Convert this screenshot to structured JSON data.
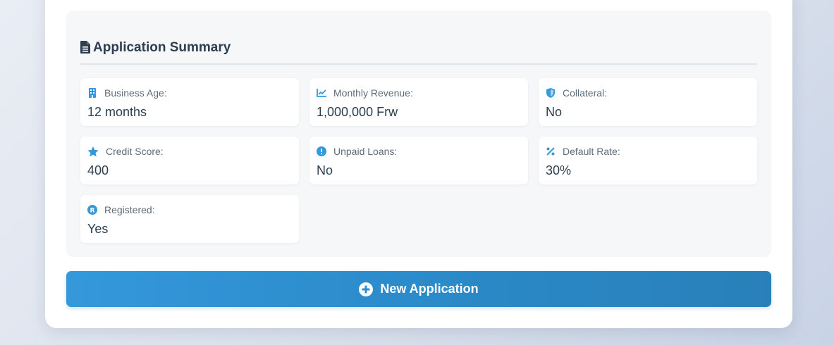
{
  "summary": {
    "title": "Application Summary",
    "icon": "file-document-icon",
    "items": [
      {
        "label": "Business Age:",
        "value": "12 months",
        "icon": "building-icon"
      },
      {
        "label": "Monthly Revenue:",
        "value": "1,000,000 Frw",
        "icon": "chart-line-icon"
      },
      {
        "label": "Collateral:",
        "value": "No",
        "icon": "shield-icon"
      },
      {
        "label": "Credit Score:",
        "value": "400",
        "icon": "star-icon"
      },
      {
        "label": "Unpaid Loans:",
        "value": "No",
        "icon": "exclamation-circle-icon"
      },
      {
        "label": "Default Rate:",
        "value": "30%",
        "icon": "percent-icon"
      },
      {
        "label": "Registered:",
        "value": "Yes",
        "icon": "registered-icon"
      }
    ]
  },
  "actions": {
    "new_application_label": "New Application",
    "new_application_icon": "plus-circle-icon"
  },
  "colors": {
    "accent": "#3498db",
    "text_dark": "#2c3e50",
    "text_muted": "#5d6b7a"
  }
}
